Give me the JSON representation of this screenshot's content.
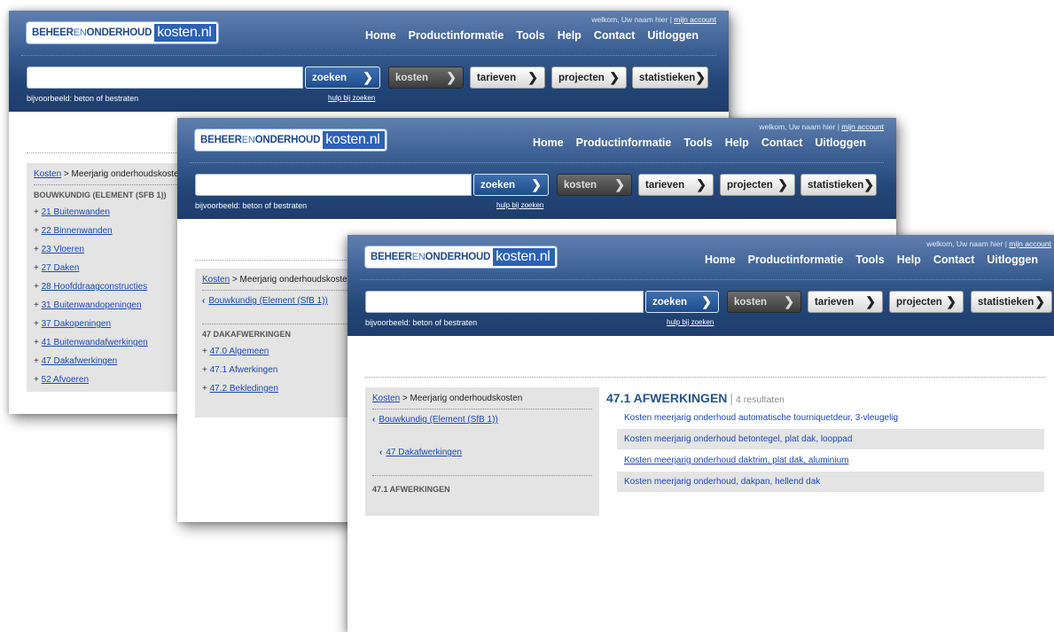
{
  "common": {
    "logo_part1_a": "BEHEER",
    "logo_part1_b": "EN",
    "logo_part1_c": "ONDERHOUD",
    "logo_part2": "kosten.nl",
    "welcome_text": "welkom, Uw naam hier | ",
    "account_link": "mijn account",
    "nav": [
      "Home",
      "Productinformatie",
      "Tools",
      "Help",
      "Contact",
      "Uitloggen"
    ],
    "buttons": {
      "zoeken": "zoeken",
      "kosten": "kosten",
      "tarieven": "tarieven",
      "projecten": "projecten",
      "statistieken": "statistieken"
    },
    "search_hint": "bijvoorbeeld: beton of bestraten",
    "search_help": "hulp bij zoeken",
    "crumb_link": "Kosten",
    "crumb_sep": " > ",
    "crumb_text": "Meerjarig onderhoudskosten"
  },
  "window1": {
    "category_heading": "BOUWKUNDIG (ELEMENT (SFB 1))",
    "items": [
      {
        "prefix": "+ ",
        "label": "21 Buitenwanden"
      },
      {
        "prefix": "+ ",
        "label": "22 Binnenwanden"
      },
      {
        "prefix": "+ ",
        "label": "23 Vloeren"
      },
      {
        "prefix": "+ ",
        "label": "27 Daken"
      },
      {
        "prefix": "+ ",
        "label": "28 Hoofddraagconstructies"
      },
      {
        "prefix": "+ ",
        "label": "31 Buitenwandopeningen"
      },
      {
        "prefix": "+ ",
        "label": "37 Dakopeningen"
      },
      {
        "prefix": "+ ",
        "label": "41 Buitenwandafwerkingen"
      },
      {
        "prefix": "+ ",
        "label": "47 Dakafwerkingen"
      },
      {
        "prefix": "+ ",
        "label": "52 Afvoeren"
      }
    ]
  },
  "window2": {
    "back_link": "Bouwkundig (Element (SfB 1))",
    "category_heading": "47 DAKAFWERKINGEN",
    "items": [
      {
        "prefix": "+ ",
        "label": "47.0 Algemeen"
      },
      {
        "prefix": "+ ",
        "label": "47.1 Afwerkingen"
      },
      {
        "prefix": "+ ",
        "label": "47.2 Bekledingen"
      }
    ]
  },
  "window3": {
    "back_link_1": "Bouwkundig (Element (SfB 1))",
    "back_link_2": "47 Dakafwerkingen",
    "category_heading": "47.1 AFWERKINGEN",
    "results_title": "47.1 AFWERKINGEN",
    "results_sep": "|",
    "results_count": "4 resultaten",
    "results": [
      "Kosten meerjarig onderhoud automatische tourniquetdeur, 3-vleugelig",
      "Kosten meerjarig onderhoud betontegel, plat dak, looppad",
      "Kosten meerjarig onderhoud daktrim, plat dak, aluminium",
      "Kosten meerjarig onderhoud, dakpan, hellend dak"
    ]
  }
}
